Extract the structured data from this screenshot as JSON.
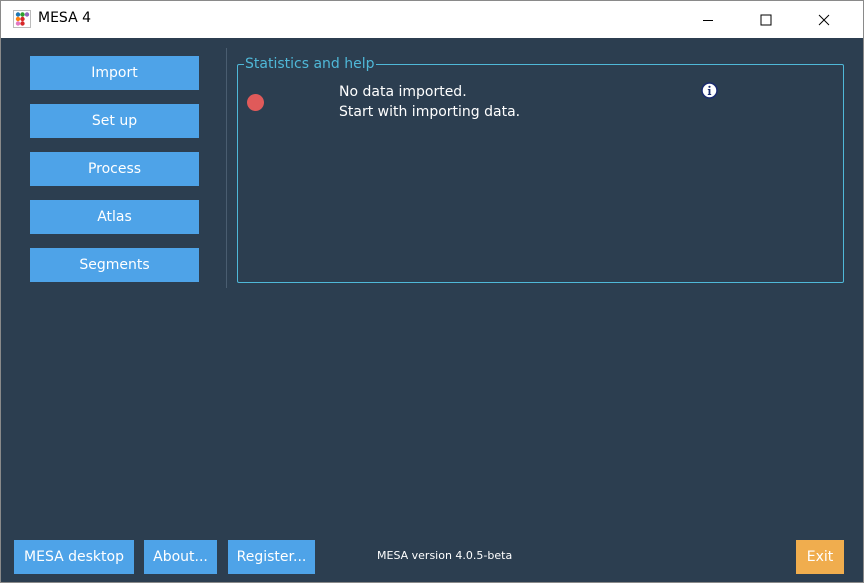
{
  "window": {
    "title": "MESA 4",
    "icon": "mesa-app-icon"
  },
  "nav": {
    "items": [
      {
        "label": "Import"
      },
      {
        "label": "Set up"
      },
      {
        "label": "Process"
      },
      {
        "label": "Atlas"
      },
      {
        "label": "Segments"
      }
    ]
  },
  "stats": {
    "legend": "Statistics and help",
    "status_color": "#e05a5a",
    "line1": "No data imported.",
    "line2": "Start with importing data.",
    "info_icon": "info-icon"
  },
  "footer": {
    "desktop_label": "MESA desktop",
    "about_label": "About...",
    "register_label": "Register...",
    "version": "MESA version 4.0.5-beta",
    "exit_label": "Exit"
  },
  "colors": {
    "background": "#2c3e50",
    "button": "#4ea3e8",
    "frame": "#4fb8d8",
    "exit": "#f0ad4e"
  }
}
